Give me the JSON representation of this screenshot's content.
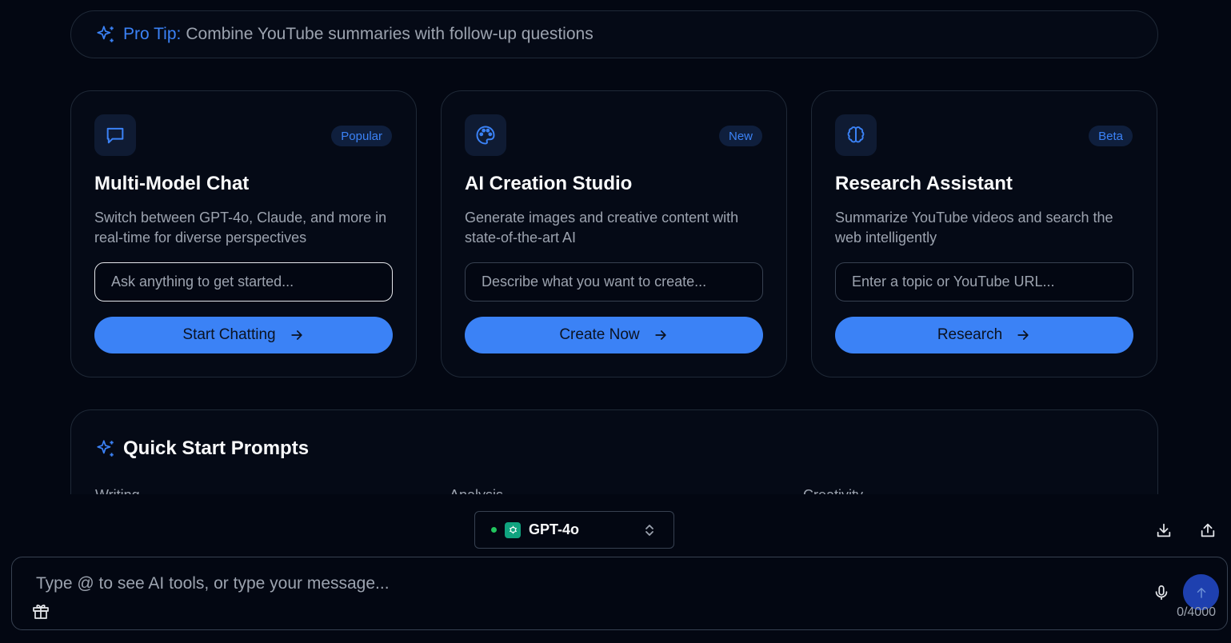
{
  "pro_tip": {
    "label": "Pro Tip:",
    "text": "Combine YouTube summaries with follow-up questions",
    "icon": "sparkles-icon"
  },
  "cards": [
    {
      "icon": "chat-bubble-icon",
      "badge": "Popular",
      "title": "Multi-Model Chat",
      "description": "Switch between GPT-4o, Claude, and more in real-time for diverse perspectives",
      "placeholder": "Ask anything to get started...",
      "button": "Start Chatting"
    },
    {
      "icon": "palette-icon",
      "badge": "New",
      "title": "AI Creation Studio",
      "description": "Generate images and creative content with state-of-the-art AI",
      "placeholder": "Describe what you want to create...",
      "button": "Create Now"
    },
    {
      "icon": "brain-icon",
      "badge": "Beta",
      "title": "Research Assistant",
      "description": "Summarize YouTube videos and search the web intelligently",
      "placeholder": "Enter a topic or YouTube URL...",
      "button": "Research"
    }
  ],
  "quick_start": {
    "title": "Quick Start Prompts",
    "categories": [
      "Writing",
      "Analysis",
      "Creativity"
    ]
  },
  "model_selector": {
    "name": "GPT-4o",
    "status_color": "#22c55e"
  },
  "composer": {
    "placeholder": "Type @ to see AI tools, or type your message...",
    "counter": "0/4000"
  },
  "colors": {
    "accent": "#3b82f6",
    "background": "#030712",
    "card": "#050a16",
    "border": "#1f2937"
  }
}
